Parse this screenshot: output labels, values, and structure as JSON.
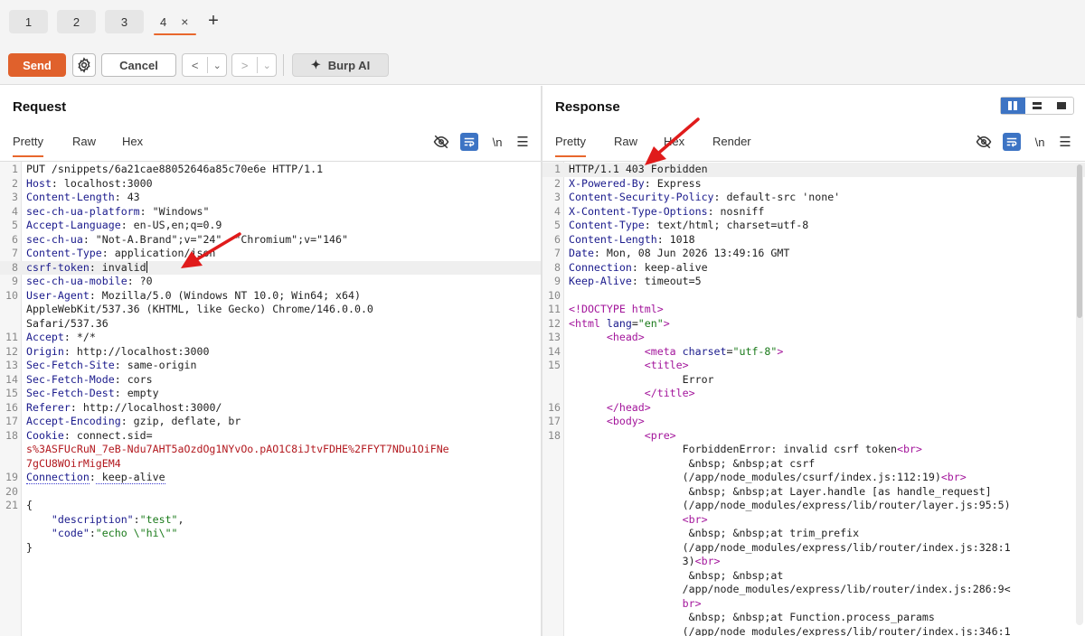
{
  "tabs": [
    {
      "label": "1"
    },
    {
      "label": "2"
    },
    {
      "label": "3"
    },
    {
      "label": "4",
      "close": "×"
    }
  ],
  "add_tab_label": "+",
  "toolbar": {
    "send_label": "Send",
    "cancel_label": "Cancel",
    "back_label": "<",
    "forward_label": ">",
    "dropdown_label": "⌄",
    "burp_ai_label": "Burp AI",
    "burp_ai_icon": "sparkle-icon",
    "settings_icon": "gear-icon"
  },
  "request": {
    "title": "Request",
    "tabs": [
      "Pretty",
      "Raw",
      "Hex"
    ],
    "active_tab": "Pretty",
    "icons": [
      "hide-icon",
      "wrap-icon",
      "newline-icon",
      "menu-icon"
    ],
    "newline_label": "\\n",
    "lines": [
      {
        "n": "1",
        "text": "PUT /snippets/6a21cae88052646a85c70e6e HTTP/1.1"
      },
      {
        "n": "2",
        "key": "Host",
        "val": " localhost:3000"
      },
      {
        "n": "3",
        "key": "Content-Length",
        "val": " 43"
      },
      {
        "n": "4",
        "key": "sec-ch-ua-platform",
        "val": " \"Windows\""
      },
      {
        "n": "5",
        "key": "Accept-Language",
        "val": " en-US,en;q=0.9"
      },
      {
        "n": "6",
        "key": "sec-ch-ua",
        "val": " \"Not-A.Brand\";v=\"24\", \"Chromium\";v=\"146\""
      },
      {
        "n": "7",
        "key": "Content-Type",
        "val": " application/json"
      },
      {
        "n": "8",
        "key": "csrf-token",
        "val": " invalid",
        "highlight": true
      },
      {
        "n": "9",
        "key": "sec-ch-ua-mobile",
        "val": " ?0"
      },
      {
        "n": "10",
        "key": "User-Agent",
        "val": " Mozilla/5.0 (Windows NT 10.0; Win64; x64)"
      },
      {
        "n": "",
        "text": "AppleWebKit/537.36 (KHTML, like Gecko) Chrome/146.0.0.0"
      },
      {
        "n": "",
        "text": "Safari/537.36"
      },
      {
        "n": "11",
        "key": "Accept",
        "val": " */*"
      },
      {
        "n": "12",
        "key": "Origin",
        "val": " http://localhost:3000"
      },
      {
        "n": "13",
        "key": "Sec-Fetch-Site",
        "val": " same-origin"
      },
      {
        "n": "14",
        "key": "Sec-Fetch-Mode",
        "val": " cors"
      },
      {
        "n": "15",
        "key": "Sec-Fetch-Dest",
        "val": " empty"
      },
      {
        "n": "16",
        "key": "Referer",
        "val": " http://localhost:3000/"
      },
      {
        "n": "17",
        "key": "Accept-Encoding",
        "val": " gzip, deflate, br"
      },
      {
        "n": "18",
        "key": "Cookie",
        "val": " connect.sid="
      },
      {
        "n": "",
        "cookie": "s%3ASFUcRuN_7eB-Ndu7AHT5aOzdOg1NYvOo.pAO1C8iJtvFDHE%2FFYT7NDu1OiFNe"
      },
      {
        "n": "",
        "cookie": "7gCU8WOirMigEM4"
      },
      {
        "n": "19",
        "key": "Connection",
        "val": " keep-alive",
        "dotted": true
      },
      {
        "n": "20",
        "text": ""
      },
      {
        "n": "21",
        "text": "{"
      },
      {
        "n": "",
        "jkey": "\"description\"",
        "jval": "\"test\"",
        "sep": ":",
        "tail": ","
      },
      {
        "n": "",
        "jkey": "\"code\"",
        "jval": "\"echo \\\"hi\\\"\"",
        "sep": ":",
        "tail": ""
      },
      {
        "n": "",
        "text": "}"
      }
    ]
  },
  "response": {
    "title": "Response",
    "tabs": [
      "Pretty",
      "Raw",
      "Hex",
      "Render"
    ],
    "active_tab": "Pretty",
    "icons": [
      "hide-icon",
      "wrap-icon",
      "newline-icon",
      "menu-icon"
    ],
    "newline_label": "\\n",
    "view_modes": [
      "split-view-icon",
      "horizontal-view-icon",
      "single-view-icon"
    ],
    "lines": [
      {
        "n": "1",
        "text": "HTTP/1.1 403 Forbidden",
        "highlight": true
      },
      {
        "n": "2",
        "key": "X-Powered-By",
        "val": " Express"
      },
      {
        "n": "3",
        "key": "Content-Security-Policy",
        "val": " default-src 'none'"
      },
      {
        "n": "4",
        "key": "X-Content-Type-Options",
        "val": " nosniff"
      },
      {
        "n": "5",
        "key": "Content-Type",
        "val": " text/html; charset=utf-8"
      },
      {
        "n": "6",
        "key": "Content-Length",
        "val": " 1018"
      },
      {
        "n": "7",
        "key": "Date",
        "val": " Mon, 08 Jun 2026 13:49:16 GMT"
      },
      {
        "n": "8",
        "key": "Connection",
        "val": " keep-alive"
      },
      {
        "n": "9",
        "key": "Keep-Alive",
        "val": " timeout=5"
      },
      {
        "n": "10",
        "text": ""
      },
      {
        "n": "11",
        "tagtext": "<!DOCTYPE html>"
      },
      {
        "n": "12",
        "html": "<html",
        "attr": " lang",
        "eq": "=",
        "sval": "\"en\"",
        "close": ">"
      },
      {
        "n": "13",
        "indent": "      ",
        "tagtext": "<head>"
      },
      {
        "n": "14",
        "indent": "            ",
        "html": "<meta",
        "attr": " charset",
        "eq": "=",
        "sval": "\"utf-8\"",
        "close": ">"
      },
      {
        "n": "15",
        "indent": "            ",
        "tagtext": "<title>"
      },
      {
        "n": "",
        "indent": "                  ",
        "text": "Error"
      },
      {
        "n": "",
        "indent": "            ",
        "tagtext": "</title>"
      },
      {
        "n": "16",
        "indent": "      ",
        "tagtext": "</head>"
      },
      {
        "n": "17",
        "indent": "      ",
        "tagtext": "<body>"
      },
      {
        "n": "18",
        "indent": "            ",
        "tagtext": "<pre>"
      },
      {
        "n": "",
        "indent": "                  ",
        "text": "ForbiddenError: invalid csrf token",
        "trail": "<br>"
      },
      {
        "n": "",
        "indent": "                   ",
        "text": "&nbsp; &nbsp;at csrf"
      },
      {
        "n": "",
        "indent": "                  ",
        "text": "(/app/node_modules/csurf/index.js:112:19)",
        "trail": "<br>"
      },
      {
        "n": "",
        "indent": "                   ",
        "text": "&nbsp; &nbsp;at Layer.handle [as handle_request]"
      },
      {
        "n": "",
        "indent": "                  ",
        "text": "(/app/node_modules/express/lib/router/layer.js:95:5)"
      },
      {
        "n": "",
        "indent": "                  ",
        "tagtext": "<br>"
      },
      {
        "n": "",
        "indent": "                   ",
        "text": "&nbsp; &nbsp;at trim_prefix"
      },
      {
        "n": "",
        "indent": "                  ",
        "text": "(/app/node_modules/express/lib/router/index.js:328:1"
      },
      {
        "n": "",
        "indent": "                  ",
        "text": "3)",
        "trail": "<br>"
      },
      {
        "n": "",
        "indent": "                   ",
        "text": "&nbsp; &nbsp;at"
      },
      {
        "n": "",
        "indent": "                  ",
        "text": "/app/node_modules/express/lib/router/index.js:286:9<"
      },
      {
        "n": "",
        "indent": "                  ",
        "tagtext": "br>"
      },
      {
        "n": "",
        "indent": "                   ",
        "text": "&nbsp; &nbsp;at Function.process_params"
      },
      {
        "n": "",
        "indent": "                  ",
        "text": "(/app/node_modules/express/lib/router/index.js:346:1"
      }
    ]
  },
  "colors": {
    "accent": "#e0612c",
    "annotation_arrow": "#e01b1b",
    "header_key": "#1a1a8c",
    "cookie_value": "#b3191f",
    "html_tag": "#a3159b",
    "string_value": "#1a7a1a",
    "toggle_active": "#3d74c4"
  }
}
